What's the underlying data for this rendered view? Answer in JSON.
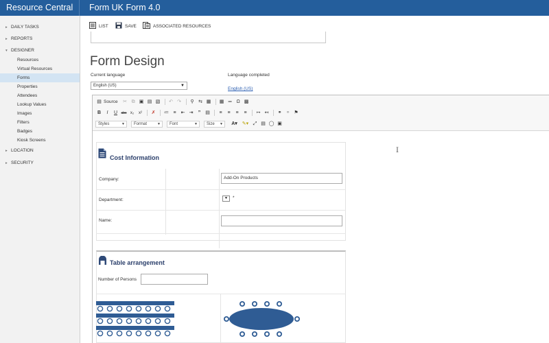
{
  "app_title": "Resource Central",
  "window_title": "Form UK Form 4.0",
  "sidebar": {
    "groups": [
      {
        "label": "DAILY TASKS",
        "expanded": false
      },
      {
        "label": "REPORTS",
        "expanded": false
      },
      {
        "label": "DESIGNER",
        "expanded": true
      },
      {
        "label": "LOCATION",
        "expanded": false
      },
      {
        "label": "SECURITY",
        "expanded": false
      }
    ],
    "designer_items": [
      "Resources",
      "Virtual Resources",
      "Forms",
      "Properties",
      "Attendees",
      "Lookup Values",
      "Images",
      "Filters",
      "Badges",
      "Kiosk Screens"
    ],
    "active_item": "Forms"
  },
  "toolbar": {
    "list_label": "LIST",
    "save_label": "SAVE",
    "associated_label": "ASSOCIATED RESOURCES"
  },
  "page_title": "Form Design",
  "current_language_label": "Current language",
  "current_language_value": "English (US)",
  "language_completed_label": "Language completed",
  "language_completed_link": "English (US)",
  "editor": {
    "source_label": "Source",
    "styles_label": "Styles",
    "format_label": "Format",
    "font_label": "Font",
    "size_label": "Size"
  },
  "cost_section": {
    "title": "Cost Information",
    "company_label": "Company:",
    "company_value": "Add-On Products",
    "department_label": "Department:",
    "department_marker": "*",
    "name_label": "Name:",
    "name_value": ""
  },
  "table_section": {
    "title": "Table arrangement",
    "persons_label": "Number of Persons",
    "persons_value": ""
  },
  "colors": {
    "topbar": "#245e9c",
    "sidebar_bg": "#f2f2f2",
    "active_item_bg": "#d3e4f3",
    "section_title": "#2b3f6b",
    "table_art": "#2f5c94",
    "link": "#2a5db0"
  }
}
